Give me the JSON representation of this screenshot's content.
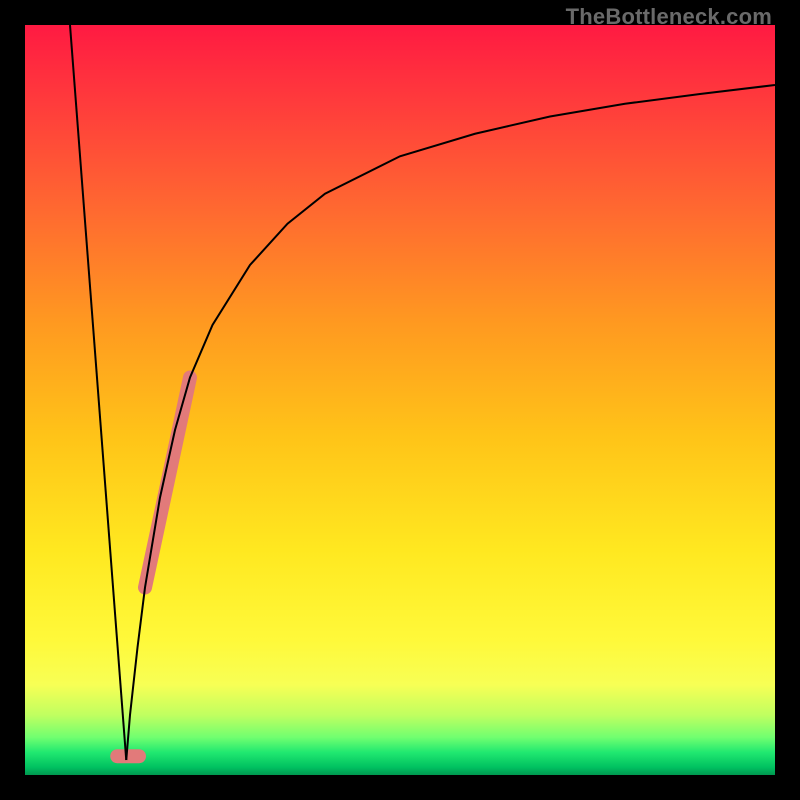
{
  "watermark": "TheBottleneck.com",
  "chart_data": {
    "type": "line",
    "title": "",
    "xlabel": "",
    "ylabel": "",
    "xlim": [
      0,
      100
    ],
    "ylim": [
      0,
      100
    ],
    "grid": false,
    "legend": false,
    "series": [
      {
        "name": "left-arm",
        "stroke": "#000000",
        "stroke_width": 2,
        "x": [
          6,
          13.5
        ],
        "values": [
          100,
          2
        ]
      },
      {
        "name": "right-arm",
        "stroke": "#000000",
        "stroke_width": 2,
        "x": [
          13.5,
          14,
          15,
          16,
          18,
          20,
          22,
          25,
          30,
          35,
          40,
          50,
          60,
          70,
          80,
          90,
          100
        ],
        "values": [
          2,
          8,
          17,
          25,
          37,
          46,
          53,
          60,
          68,
          73.5,
          77.5,
          82.5,
          85.5,
          87.8,
          89.5,
          90.8,
          92
        ]
      },
      {
        "name": "highlight-segment",
        "stroke": "#e27a7a",
        "stroke_width": 14,
        "linecap": "round",
        "x": [
          16,
          22
        ],
        "values": [
          25,
          53
        ]
      },
      {
        "name": "min-marker",
        "stroke": "#e27a7a",
        "stroke_width": 14,
        "linecap": "round",
        "x": [
          12.3,
          15.2
        ],
        "values": [
          2.5,
          2.5
        ]
      }
    ],
    "gradient_stops": [
      {
        "pos": 0,
        "color": "#ff1a42"
      },
      {
        "pos": 25,
        "color": "#ff6a30"
      },
      {
        "pos": 55,
        "color": "#ffc418"
      },
      {
        "pos": 82,
        "color": "#fff93a"
      },
      {
        "pos": 95,
        "color": "#70ff70"
      },
      {
        "pos": 100,
        "color": "#009850"
      }
    ]
  }
}
